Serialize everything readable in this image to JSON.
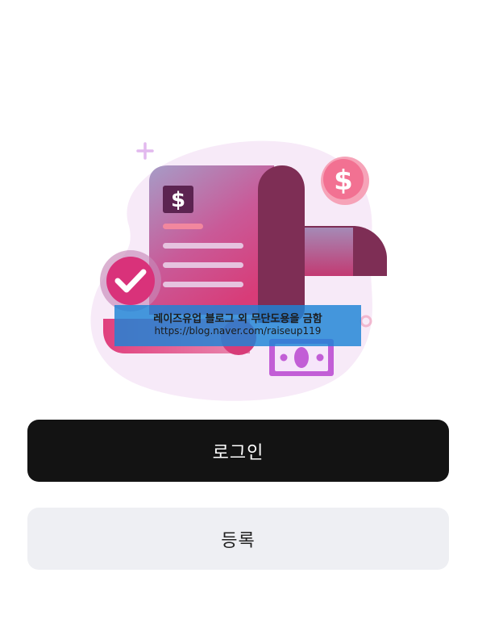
{
  "illustration": {
    "icon_names": [
      "invoice-document-icon",
      "dollar-coin-icon",
      "check-badge-icon",
      "banknote-icon",
      "plus-sparkle-icon"
    ],
    "colors": {
      "blob": "#f7eaf8",
      "paper_gradient_top": "#a79bc6",
      "paper_gradient_bottom": "#d83c7c",
      "paper_roll": "#7e2e55",
      "coin": "#f27192",
      "check": "#d9327a",
      "bill": "#c25ed6",
      "accent_plus": "#e2b9ee"
    }
  },
  "watermark": {
    "line1": "레이즈유업 블로그 외 무단도용을 금함",
    "line2": "https://blog.naver.com/raiseup119"
  },
  "actions": {
    "login_label": "로그인",
    "register_label": "등록"
  },
  "colors": {
    "primary_button": "#131313",
    "secondary_button": "#eeeff3"
  }
}
